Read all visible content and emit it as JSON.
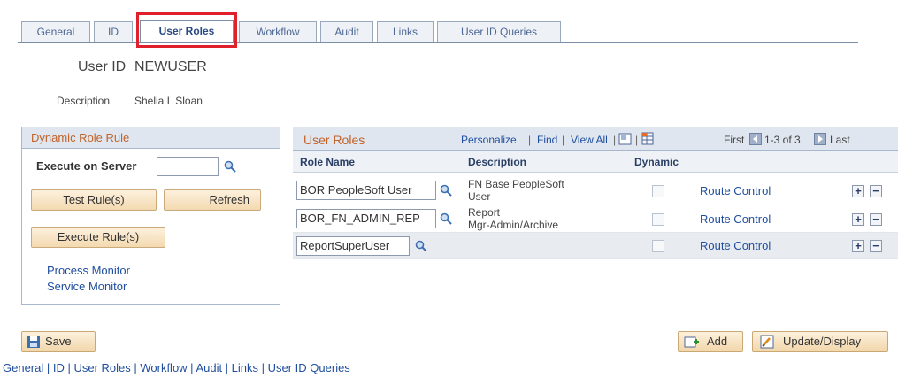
{
  "tabs": [
    {
      "label": "General"
    },
    {
      "label": "ID"
    },
    {
      "label": "User Roles"
    },
    {
      "label": "Workflow"
    },
    {
      "label": "Audit"
    },
    {
      "label": "Links"
    },
    {
      "label": "User ID Queries"
    }
  ],
  "header": {
    "user_id_label": "User ID",
    "user_id_value": "NEWUSER",
    "description_label": "Description",
    "description_value": "Shelia L Sloan"
  },
  "dynamic_panel": {
    "title": "Dynamic Role Rule",
    "execute_on_server_label": "Execute on Server",
    "execute_on_server_value": "",
    "test_rule_button": "Test Rule(s)",
    "refresh_button": "Refresh",
    "execute_rule_button": "Execute Rule(s)",
    "process_monitor_link": "Process Monitor",
    "service_monitor_link": "Service Monitor"
  },
  "grid": {
    "title": "User Roles",
    "personalize": "Personalize",
    "find": "Find",
    "view_all": "View All",
    "sep": "|",
    "first": "First",
    "range": "1-3 of 3",
    "last": "Last",
    "columns": {
      "role_name": "Role Name",
      "description": "Description",
      "dynamic": "Dynamic"
    },
    "rows": [
      {
        "role": "BOR PeopleSoft User",
        "desc1": "FN Base PeopleSoft",
        "desc2": "User",
        "route": "Route Control"
      },
      {
        "role": "BOR_FN_ADMIN_REP",
        "desc1": "Report",
        "desc2": "Mgr-Admin/Archive",
        "route": "Route Control"
      },
      {
        "role": "ReportSuperUser",
        "desc1": "",
        "desc2": "",
        "route": "Route Control"
      }
    ]
  },
  "footer": {
    "save_button": "Save",
    "add_button": "Add",
    "update_button": "Update/Display",
    "links": "General | ID | User Roles | Workflow | Audit | Links | User ID Queries"
  },
  "colors": {
    "highlight": "#e0202a",
    "link": "#1f4e9e",
    "panel_title": "#c1632a"
  }
}
